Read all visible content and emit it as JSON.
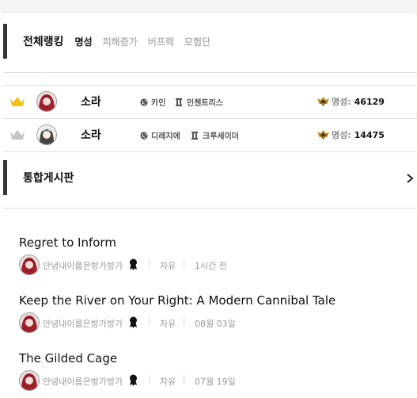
{
  "ranking": {
    "title": "전체랭킹",
    "tabs": [
      {
        "label": "명성",
        "active": true
      },
      {
        "label": "피해증가",
        "active": false
      },
      {
        "label": "버프력",
        "active": false
      },
      {
        "label": "모험단",
        "active": false
      }
    ],
    "rows": [
      {
        "crown": "gold-crown-icon",
        "crown_color": "#f2c21b",
        "name": "소라",
        "server": "카인",
        "job": "인첸트리스",
        "fame_label": "명성:",
        "fame_value": "46129"
      },
      {
        "crown": "silver-crown-icon",
        "crown_color": "#c4c4c4",
        "name": "소라",
        "server": "디레지에",
        "job": "크루세이더",
        "fame_label": "명성:",
        "fame_value": "14475"
      }
    ]
  },
  "board": {
    "title": "통합게시판",
    "posts": [
      {
        "title": "Regret to Inform",
        "author": "안녕내이름은방가방가",
        "category": "자유",
        "time": "1시간 전"
      },
      {
        "title": "Keep the River on Your Right: A Modern Cannibal Tale",
        "author": "안녕내이름은방가방가",
        "category": "자유",
        "time": "08월 03일"
      },
      {
        "title": "The Gilded Cage",
        "author": "안녕내이름은방가방가",
        "category": "자유",
        "time": "07월 19일"
      }
    ],
    "separator": "|"
  },
  "colors": {
    "accent_bar": "#333333",
    "muted_text": "#999999",
    "gold": "#f2c21b",
    "silver": "#c4c4c4"
  }
}
